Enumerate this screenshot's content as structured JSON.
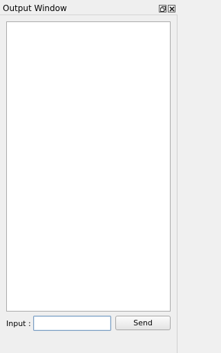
{
  "window": {
    "title": "Output Window"
  },
  "titlebar_buttons": {
    "float": "float-icon",
    "close": "close-icon"
  },
  "output": {
    "text": ""
  },
  "input": {
    "label": "Input :",
    "value": "",
    "placeholder": ""
  },
  "send": {
    "label": "Send"
  }
}
